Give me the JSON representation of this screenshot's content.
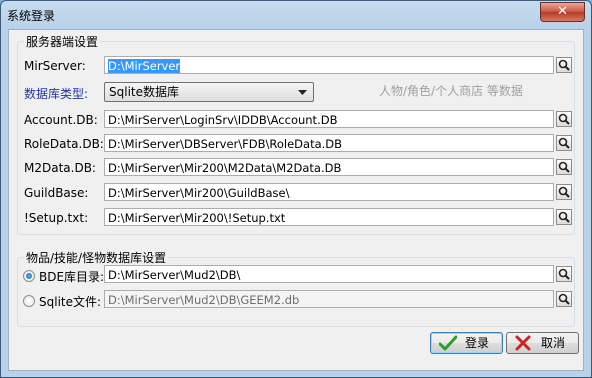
{
  "window": {
    "title": "系统登录",
    "close_glyph": "✕"
  },
  "server_group": {
    "title": "服务器端设置",
    "mirserver": {
      "label": "MirServer:",
      "value": "D:\\MirServer"
    },
    "db_type": {
      "label": "数据库类型:",
      "selected": "Sqlite数据库",
      "hint": "人物/角色/个人商店 等数据"
    },
    "account_db": {
      "label": "Account.DB:",
      "value": "D:\\MirServer\\LoginSrv\\IDDB\\Account.DB"
    },
    "roledata_db": {
      "label": "RoleData.DB:",
      "value": "D:\\MirServer\\DBServer\\FDB\\RoleData.DB"
    },
    "m2data_db": {
      "label": "M2Data.DB:",
      "value": "D:\\MirServer\\Mir200\\M2Data\\M2Data.DB"
    },
    "guildbase": {
      "label": "GuildBase:",
      "value": "D:\\MirServer\\Mir200\\GuildBase\\"
    },
    "setup_txt": {
      "label": "!Setup.txt:",
      "value": "D:\\MirServer\\Mir200\\!Setup.txt"
    }
  },
  "item_group": {
    "title": "物品/技能/怪物数据库设置",
    "bde": {
      "label": "BDE库目录:",
      "value": "D:\\MirServer\\Mud2\\DB\\",
      "checked": true
    },
    "sqlite": {
      "label": "Sqlite文件:",
      "value": "D:\\MirServer\\Mud2\\DB\\GEEM2.db",
      "checked": false
    }
  },
  "buttons": {
    "login": "登录",
    "cancel": "取消"
  },
  "colors": {
    "label_blue": "#2233aa",
    "selection": "#3399ff",
    "check_green": "#2a9d2a",
    "cancel_red": "#cc2222"
  }
}
